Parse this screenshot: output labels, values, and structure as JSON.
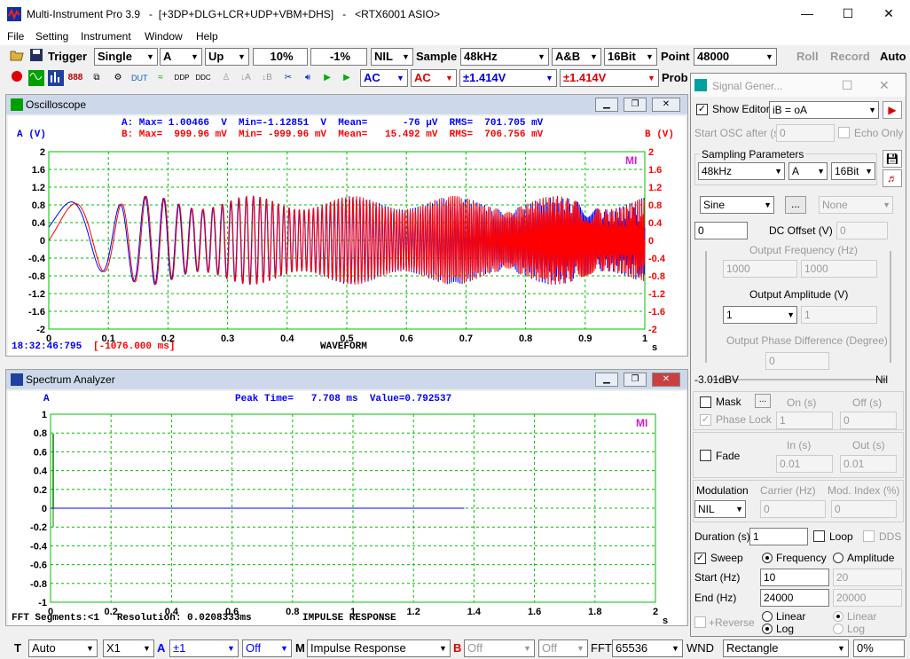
{
  "app": {
    "title": "Multi-Instrument Pro 3.9   -  [+3DP+DLG+LCR+UDP+VBM+DHS]   -   <RTX6001 ASIO>"
  },
  "menu": [
    "File",
    "Setting",
    "Instrument",
    "Window",
    "Help"
  ],
  "toolbar1": {
    "trigger_label": "Trigger",
    "trigger_mode": "Single",
    "trigger_source": "A",
    "trigger_edge": "Up",
    "trigger_level": "10%",
    "trigger_pretrigger": "-1%",
    "nil": "NIL",
    "sample_label": "Sample",
    "sample_rate": "48kHz",
    "channels": "A&B",
    "bits": "16Bit",
    "point_label": "Point",
    "points": "48000",
    "roll": "Roll",
    "record": "Record",
    "auto": "Auto"
  },
  "toolbar2": {
    "coupling_a": "AC",
    "coupling_b": "AC",
    "range_a": "±1.414V",
    "range_b": "±1.414V",
    "probe": "Prob"
  },
  "oscilloscope": {
    "title": "Oscilloscope",
    "stats_a": "A: Max= 1.00466  V  Min=-1.12851  V  Mean=      -76 μV  RMS=  701.705 mV",
    "stats_b": "B: Max=  999.96 mV  Min= -999.96 mV  Mean=   15.492 mV  RMS=  706.756 mV",
    "axis_a": "A (V)",
    "axis_b": "B (V)",
    "mi": "MI",
    "y_ticks": [
      "2",
      "1.6",
      "1.2",
      "0.8",
      "0.4",
      "0",
      "-0.4",
      "-0.8",
      "-1.2",
      "-1.6",
      "-2"
    ],
    "x_ticks": [
      "0",
      "0.1",
      "0.2",
      "0.3",
      "0.4",
      "0.5",
      "0.6",
      "0.7",
      "0.8",
      "0.9",
      "1"
    ],
    "x_unit": "s",
    "time": "18:32:46:795",
    "offset": "[-1076.000 ms]",
    "mode": "WAVEFORM",
    "colors": {
      "a": "#0000ff",
      "b": "#ff0000",
      "grid": "#00c000"
    }
  },
  "spectrum": {
    "title": "Spectrum Analyzer",
    "axis": "A",
    "peak": "Peak Time=   7.708 ms  Value=0.792537",
    "mi": "MI",
    "y_ticks": [
      "1",
      "0.8",
      "0.6",
      "0.4",
      "0.2",
      "0",
      "-0.2",
      "-0.4",
      "-0.6",
      "-0.8",
      "-1"
    ],
    "x_ticks": [
      "0",
      "0.2",
      "0.4",
      "0.6",
      "0.8",
      "1",
      "1.2",
      "1.4",
      "1.6",
      "1.8",
      "2"
    ],
    "x_unit": "s",
    "segments": "FFT Segments:<1   Resolution: 0.0208333ms",
    "mode": "IMPULSE RESPONSE"
  },
  "siggen": {
    "title": "Signal Gener...",
    "show_editor": "Show Editor",
    "editor_formula": "iB = oA",
    "start_osc": "Start OSC after (s)",
    "start_osc_val": "0",
    "echo_only": "Echo Only",
    "sampling_title": "Sampling Parameters",
    "rate": "48kHz",
    "channel": "A",
    "bits": "16Bit",
    "waveform": "Sine",
    "dots": "...",
    "none": "None",
    "dc_offset_val": "0",
    "dc_offset_label": "DC Offset (V)",
    "dc_offset_b": "0",
    "out_freq_label": "Output Frequency (Hz)",
    "freq_a": "1000",
    "freq_b": "1000",
    "out_amp_label": "Output Amplitude (V)",
    "amp_a": "1",
    "amp_b": "1",
    "phase_label": "Output Phase Difference (Degree)",
    "phase_val": "0",
    "level_left": "-3.01dBV",
    "level_right": "Nil",
    "mask": "Mask",
    "on_label": "On (s)",
    "off_label": "Off (s)",
    "phase_lock": "Phase Lock",
    "on_val": "1",
    "off_val": "0",
    "fade": "Fade",
    "in_label": "In (s)",
    "out_label": "Out (s)",
    "in_val": "0.01",
    "out_val": "0.01",
    "modulation": "Modulation",
    "carrier": "Carrier (Hz)",
    "mod_index": "Mod. Index (%)",
    "mod_val": "NIL",
    "carrier_val": "0",
    "mod_index_val": "0",
    "duration_label": "Duration (s)",
    "duration_val": "1",
    "loop": "Loop",
    "dds": "DDS",
    "sweep": "Sweep",
    "frequency": "Frequency",
    "amplitude": "Amplitude",
    "start_label": "Start (Hz)",
    "start_a": "10",
    "start_b": "20",
    "end_label": "End (Hz)",
    "end_a": "24000",
    "end_b": "20000",
    "reverse": "+Reverse",
    "linear": "Linear",
    "log": "Log",
    "linear_b": "Linear",
    "log_b": "Log"
  },
  "statusbar": {
    "t": "T",
    "auto": "Auto",
    "x1": "X1",
    "a": "A",
    "a_range": "±1",
    "off1": "Off",
    "m": "M",
    "mode": "Impulse Response",
    "b": "B",
    "off2": "Off",
    "off3": "Off",
    "fft": "FFT",
    "fft_size": "65536",
    "wnd": "WND",
    "window": "Rectangle",
    "pct": "0%"
  }
}
